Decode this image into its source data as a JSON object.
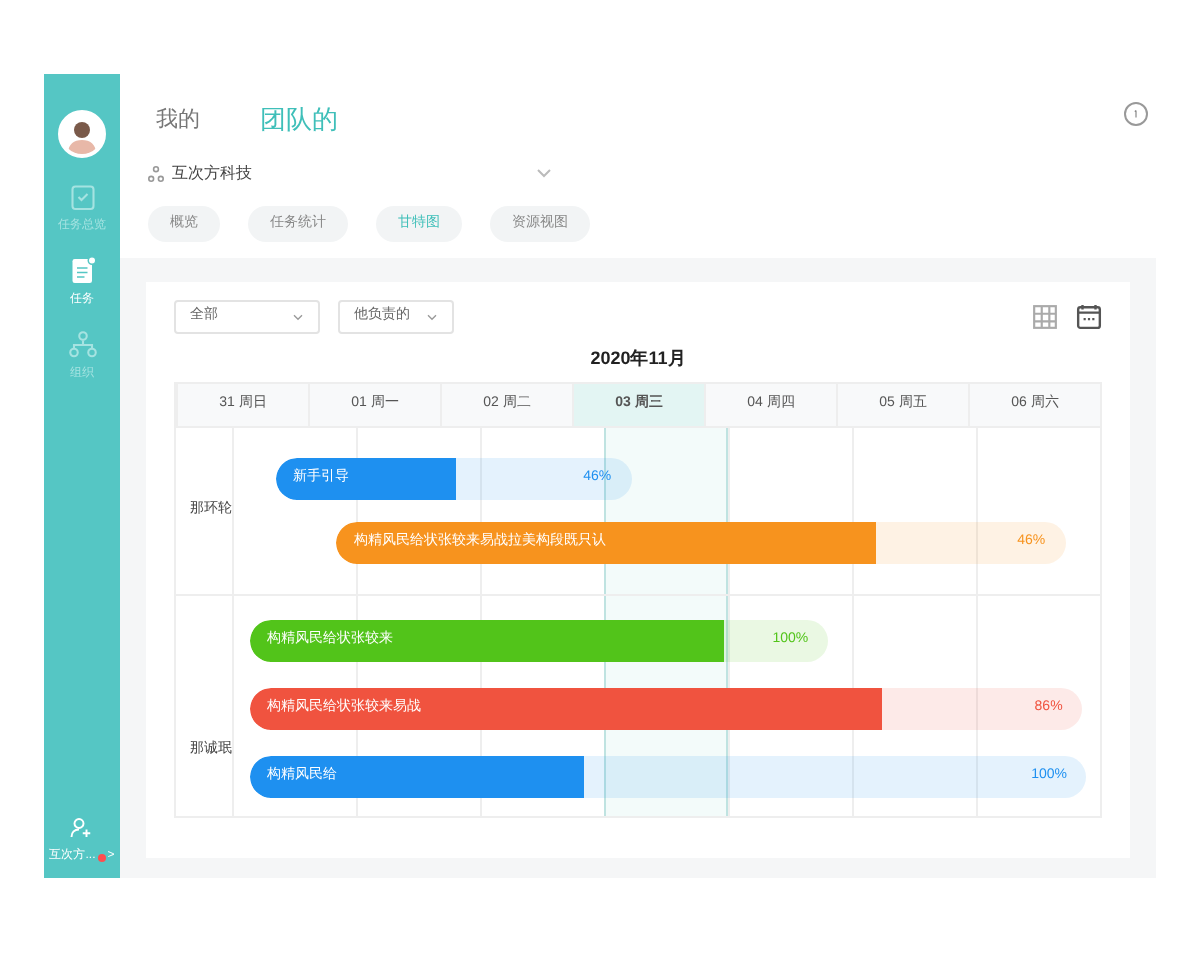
{
  "sidebar": {
    "items": [
      {
        "label": "任务总览",
        "selected": false,
        "kind": "overview"
      },
      {
        "label": "任务",
        "selected": true,
        "kind": "task"
      },
      {
        "label": "组织",
        "selected": false,
        "kind": "org"
      }
    ],
    "footer": {
      "label": "互次方...",
      "badge": true,
      "chevron": ">"
    }
  },
  "header": {
    "tabs": [
      {
        "label": "我的",
        "selected": false
      },
      {
        "label": "团队的",
        "selected": true
      }
    ]
  },
  "org": {
    "name": "互次方科技"
  },
  "view_tabs": [
    {
      "label": "概览",
      "selected": false
    },
    {
      "label": "任务统计",
      "selected": false
    },
    {
      "label": "甘特图",
      "selected": true
    },
    {
      "label": "资源视图",
      "selected": false
    }
  ],
  "filters": [
    {
      "value": "全部"
    },
    {
      "value": "他负责的"
    }
  ],
  "view_toggle": [
    {
      "kind": "table",
      "selected": false
    },
    {
      "kind": "calendar",
      "selected": true
    }
  ],
  "gantt": {
    "month": "2020年11月",
    "days": [
      {
        "label": "31 周日",
        "today": false
      },
      {
        "label": "01 周一",
        "today": false
      },
      {
        "label": "02 周二",
        "today": false
      },
      {
        "label": "03 周三",
        "today": true
      },
      {
        "label": "04 周四",
        "today": false
      },
      {
        "label": "05 周五",
        "today": false
      },
      {
        "label": "06 周六",
        "today": false
      }
    ],
    "people": [
      {
        "name": "那环轮",
        "tasks": [
          {
            "title": "新手引导",
            "percent": "46%",
            "level": 0.51,
            "color": "#1e90f0"
          },
          {
            "title": "构精风民给状张较来易战拉美构段既只认",
            "percent": "46%",
            "level": 0.74,
            "color": "#f7931e"
          }
        ]
      },
      {
        "name": "那诚珉",
        "tasks": [
          {
            "title": "构精风民给状张较来",
            "percent": "100%",
            "level": 0.82,
            "color": "#52c41a"
          },
          {
            "title": "构精风民给状张较来易战",
            "percent": "86%",
            "level": 0.76,
            "color": "#f0533f"
          },
          {
            "title": "构精风民给",
            "percent": "100%",
            "level": 0.4,
            "color": "#1e90f0"
          }
        ]
      }
    ]
  }
}
